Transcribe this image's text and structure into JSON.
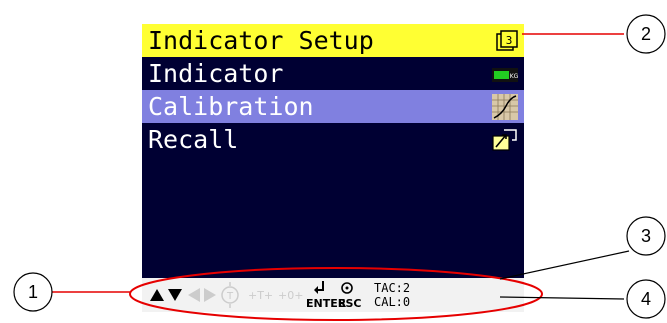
{
  "menu": {
    "header": {
      "title": "Indicator Setup",
      "icon": "page-3-icon",
      "page": "3"
    },
    "items": [
      {
        "label": "Indicator",
        "icon": "scale-display-icon",
        "icon_text": "0000 KG",
        "selected": false
      },
      {
        "label": "Calibration",
        "icon": "calibration-curve-icon",
        "selected": true
      },
      {
        "label": "Recall",
        "icon": "recall-folder-icon",
        "selected": false
      }
    ]
  },
  "softkeys": {
    "up": "up-arrow-icon",
    "down": "down-arrow-icon",
    "left": "left-arrow-icon",
    "right": "right-arrow-icon",
    "tare": "tare-icon",
    "tare_text": "T",
    "plus_t": "+T+",
    "plus_zero": "+0+",
    "enter_label": "ENTER",
    "esc_label": "ESC"
  },
  "status": {
    "tac": "TAC:2",
    "cal": "CAL:0"
  },
  "callouts": [
    "1",
    "2",
    "3",
    "4"
  ],
  "colors": {
    "header_bg": "#ffff33",
    "screen_bg": "#000033",
    "selected_bg": "#8080e0",
    "callout_line": "#e60000"
  }
}
